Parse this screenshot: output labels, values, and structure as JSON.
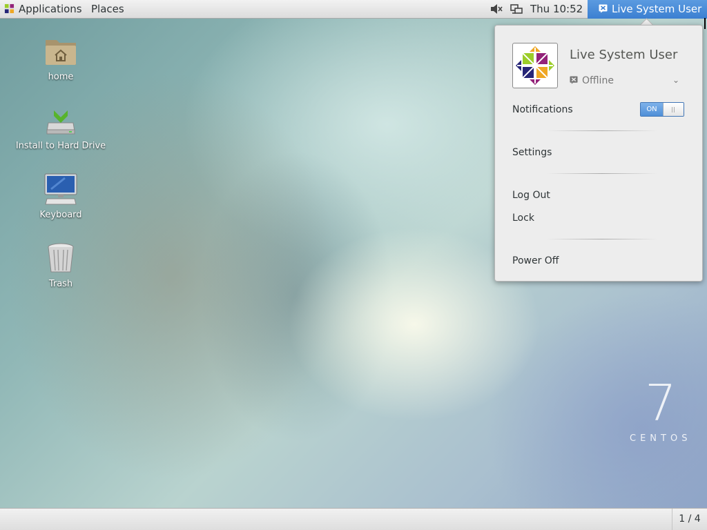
{
  "top_panel": {
    "applications_label": "Applications",
    "places_label": "Places",
    "clock": "Thu 10:52",
    "user_label": "Live System User"
  },
  "desktop_icons": [
    {
      "label": "home",
      "icon": "home-folder-icon"
    },
    {
      "label": "Install to Hard Drive",
      "icon": "install-drive-icon"
    },
    {
      "label": "Keyboard",
      "icon": "keyboard-monitor-icon"
    },
    {
      "label": "Trash",
      "icon": "trash-icon"
    }
  ],
  "user_menu": {
    "username": "Live System User",
    "presence": "Offline",
    "notifications_label": "Notifications",
    "notifications_toggle": "ON",
    "notifications_on": true,
    "settings": "Settings",
    "log_out": "Log Out",
    "lock": "Lock",
    "power_off": "Power Off"
  },
  "watermark": {
    "version": "7",
    "brand": "CENTOS"
  },
  "bottom_panel": {
    "workspace": "1 / 4"
  },
  "colors": {
    "accent": "#3b7fd1",
    "popup_bg": "#ededed",
    "panel_bg": "#e6e6e6"
  }
}
